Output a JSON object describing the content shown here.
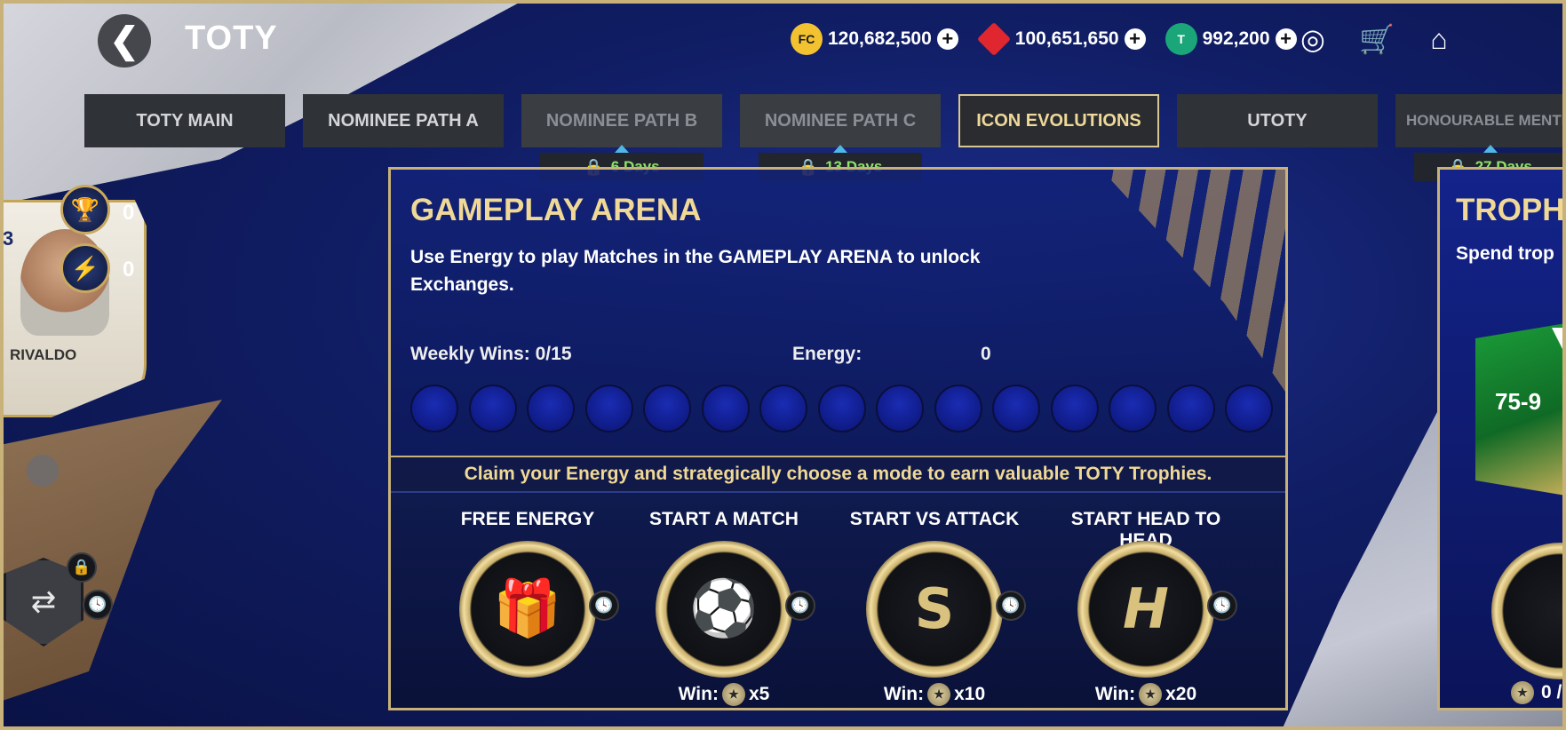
{
  "header": {
    "title": "TOTY",
    "back_icon": "chevron-left-icon",
    "currencies": [
      {
        "name": "coins",
        "value": "120,682,500",
        "color": "#f2c230",
        "icon": "coin-icon"
      },
      {
        "name": "points",
        "value": "100,651,650",
        "color": "#e0262e",
        "icon": "gem-icon"
      },
      {
        "name": "tokens",
        "value": "992,200",
        "color": "#1ba67a",
        "icon": "token-icon"
      }
    ],
    "icons": [
      "target-icon",
      "cart-icon",
      "home-icon"
    ]
  },
  "tabs": [
    {
      "label": "TOTY MAIN",
      "state": "normal"
    },
    {
      "label": "NOMINEE PATH A",
      "state": "normal"
    },
    {
      "label": "NOMINEE PATH B",
      "state": "locked",
      "lock_text": "6 Days"
    },
    {
      "label": "NOMINEE PATH C",
      "state": "locked",
      "lock_text": "13 Days"
    },
    {
      "label": "ICON EVOLUTIONS",
      "state": "active"
    },
    {
      "label": "UTOTY",
      "state": "normal"
    },
    {
      "label": "HONOURABLE MENTIONS",
      "state": "locked",
      "lock_text": "27 Days"
    }
  ],
  "player_card": {
    "name": "RIVALDO",
    "rating": "3",
    "trophy_count": "0",
    "energy_count": "0"
  },
  "panel": {
    "title": "GAMEPLAY ARENA",
    "description": "Use Energy to play Matches in the GAMEPLAY ARENA to unlock Exchanges.",
    "weekly_wins_label": "Weekly Wins: 0/15",
    "energy_label": "Energy:",
    "energy_value": "0",
    "slots_total": 15,
    "slots_filled": 0,
    "claim_text": "Claim your Energy and strategically choose a mode to earn valuable TOTY Trophies.",
    "modes": [
      {
        "label": "FREE ENERGY",
        "icon": "gift-box-icon",
        "win": ""
      },
      {
        "label": "START A MATCH",
        "icon": "football-icon",
        "win": "x5"
      },
      {
        "label": "START VS ATTACK",
        "icon": "vs-attack-icon",
        "win": "x10"
      },
      {
        "label": "START HEAD TO HEAD",
        "icon": "head-to-head-icon",
        "win": "x20"
      }
    ],
    "win_prefix": "Win:"
  },
  "side_panel": {
    "title": "TROPH",
    "description": "Spend trop",
    "pack_text": "75-9",
    "pack_badge": "?",
    "count": "0 /"
  },
  "colors": {
    "accent_gold": "#f0d996",
    "frame_gold": "#c9b27a",
    "lock_green": "#8ee56b",
    "panel_blue": "#12227a"
  }
}
